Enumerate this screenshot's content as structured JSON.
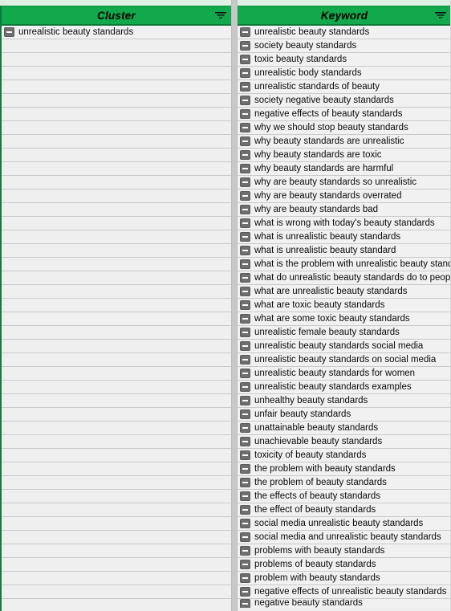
{
  "app": {
    "accent_green": "#12a84c",
    "accent_green_dark": "#0a7a36",
    "row_background": "#efefef",
    "grid_line": "#c9c9c9",
    "toggle_color": "#6e6e6e"
  },
  "columns": [
    {
      "id": "cluster",
      "header": "Cluster",
      "filter_icon": "filter-icon",
      "rows": [
        {
          "label": "unrealistic beauty standards",
          "toggle": "collapse-minus-icon",
          "has_value": true
        }
      ],
      "empty_row_count": 42
    },
    {
      "id": "keyword",
      "header": "Keyword",
      "filter_icon": "filter-icon",
      "toggle_icon": "collapse-minus-icon",
      "rows": [
        "unrealistic beauty standards",
        "society beauty standards",
        "toxic beauty standards",
        "unrealistic body standards",
        "unrealistic standards of beauty",
        "society negative beauty standards",
        "negative effects of beauty standards",
        "why we should stop beauty standards",
        "why beauty standards are unrealistic",
        "why beauty standards are toxic",
        "why beauty standards are harmful",
        "why are beauty standards so unrealistic",
        "why are beauty standards overrated",
        "why are beauty standards bad",
        "what is wrong with today's beauty standards",
        "what is unrealistic beauty standards",
        "what is unrealistic beauty standard",
        "what is the problem with unrealistic beauty standards",
        "what do unrealistic beauty standards do to people",
        "what are unrealistic beauty standards",
        "what are toxic beauty standards",
        "what are some toxic beauty standards",
        "unrealistic female beauty standards",
        "unrealistic beauty standards social media",
        "unrealistic beauty standards on social media",
        "unrealistic beauty standards for women",
        "unrealistic beauty standards examples",
        "unhealthy beauty standards",
        "unfair beauty standards",
        "unattainable beauty standards",
        "unachievable beauty standards",
        "toxicity of beauty standards",
        "the problem with beauty standards",
        "the problem of beauty standards",
        "the effects of beauty standards",
        "the effect of beauty standards",
        "social media unrealistic beauty standards",
        "social media and unrealistic beauty standards",
        "problems with beauty standards",
        "problems of beauty standards",
        "problem with beauty standards",
        "negative effects of unrealistic beauty standards",
        "negative beauty standards"
      ]
    }
  ]
}
